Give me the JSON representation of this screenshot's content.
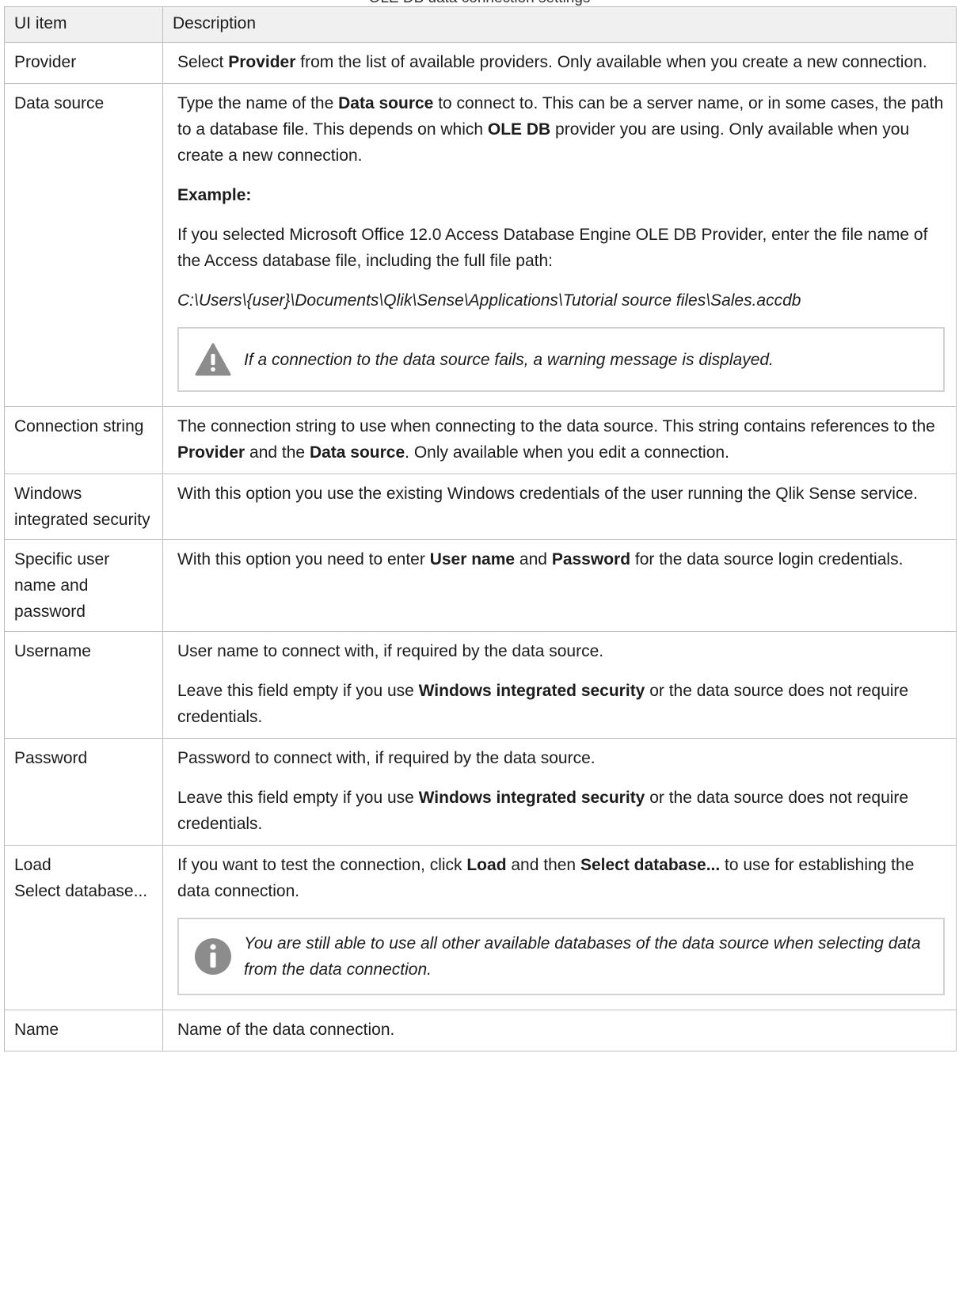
{
  "caption": "OLE DB data connection settings",
  "columns": {
    "item": "UI item",
    "description": "Description"
  },
  "rows": {
    "provider": {
      "item": "Provider",
      "d1_a": "Select ",
      "d1_b": "Provider",
      "d1_c": " from the list of available providers. Only available when you create a new connection."
    },
    "data_source": {
      "item": "Data source",
      "d1_a": "Type the name of the ",
      "d1_b": "Data source",
      "d1_c": " to connect to. This can be a server name, or in some cases, the path to a database file. This depends on which ",
      "d1_d": "OLE DB",
      "d1_e": " provider you are using. Only available when you create a new connection.",
      "example_label": "Example:",
      "example_text": "If you selected Microsoft Office 12.0 Access Database Engine OLE DB Provider, enter the file name of the Access database file, including the full file path:",
      "example_path": "C:\\Users\\{user}\\Documents\\Qlik\\Sense\\Applications\\Tutorial source files\\Sales.accdb",
      "warning": "If a connection to the data source fails, a warning message is displayed."
    },
    "connection_string": {
      "item": "Connection string",
      "d1_a": "The connection string to use when connecting to the data source. This string contains references to the ",
      "d1_b": "Provider",
      "d1_c": " and the ",
      "d1_d": "Data source",
      "d1_e": ". Only available when you edit a connection."
    },
    "windows_security": {
      "item": "Windows integrated security",
      "d1": "With this option you use the existing Windows credentials of the user running the Qlik Sense service."
    },
    "specific_user": {
      "item": "Specific user name and password",
      "d1_a": "With this option you need to enter ",
      "d1_b": "User name",
      "d1_c": " and ",
      "d1_d": "Password",
      "d1_e": " for the data source login credentials."
    },
    "username": {
      "item": "Username",
      "d1": "User name to connect with, if required by the data source.",
      "d2_a": "Leave this field empty if you use ",
      "d2_b": "Windows integrated security",
      "d2_c": " or the data source does not require credentials."
    },
    "password": {
      "item": "Password",
      "d1": "Password to connect with, if required by the data source.",
      "d2_a": "Leave this field empty if you use ",
      "d2_b": "Windows integrated security",
      "d2_c": " or the data source does not require credentials."
    },
    "load": {
      "item_1": "Load",
      "item_2": "Select database...",
      "d1_a": "If you want to test the connection, click ",
      "d1_b": "Load",
      "d1_c": " and then ",
      "d1_d": "Select database...",
      "d1_e": " to use for establishing the data connection.",
      "info": "You are still able to use all other available databases of the data source when selecting data from the data connection."
    },
    "name": {
      "item": "Name",
      "d1": "Name of the data connection."
    }
  },
  "icons": {
    "warning": "warning-icon",
    "info": "info-icon"
  },
  "colors": {
    "header_bg": "#f0f0f0",
    "border": "#bdbdbd",
    "icon_gray": "#8c8c8c"
  }
}
